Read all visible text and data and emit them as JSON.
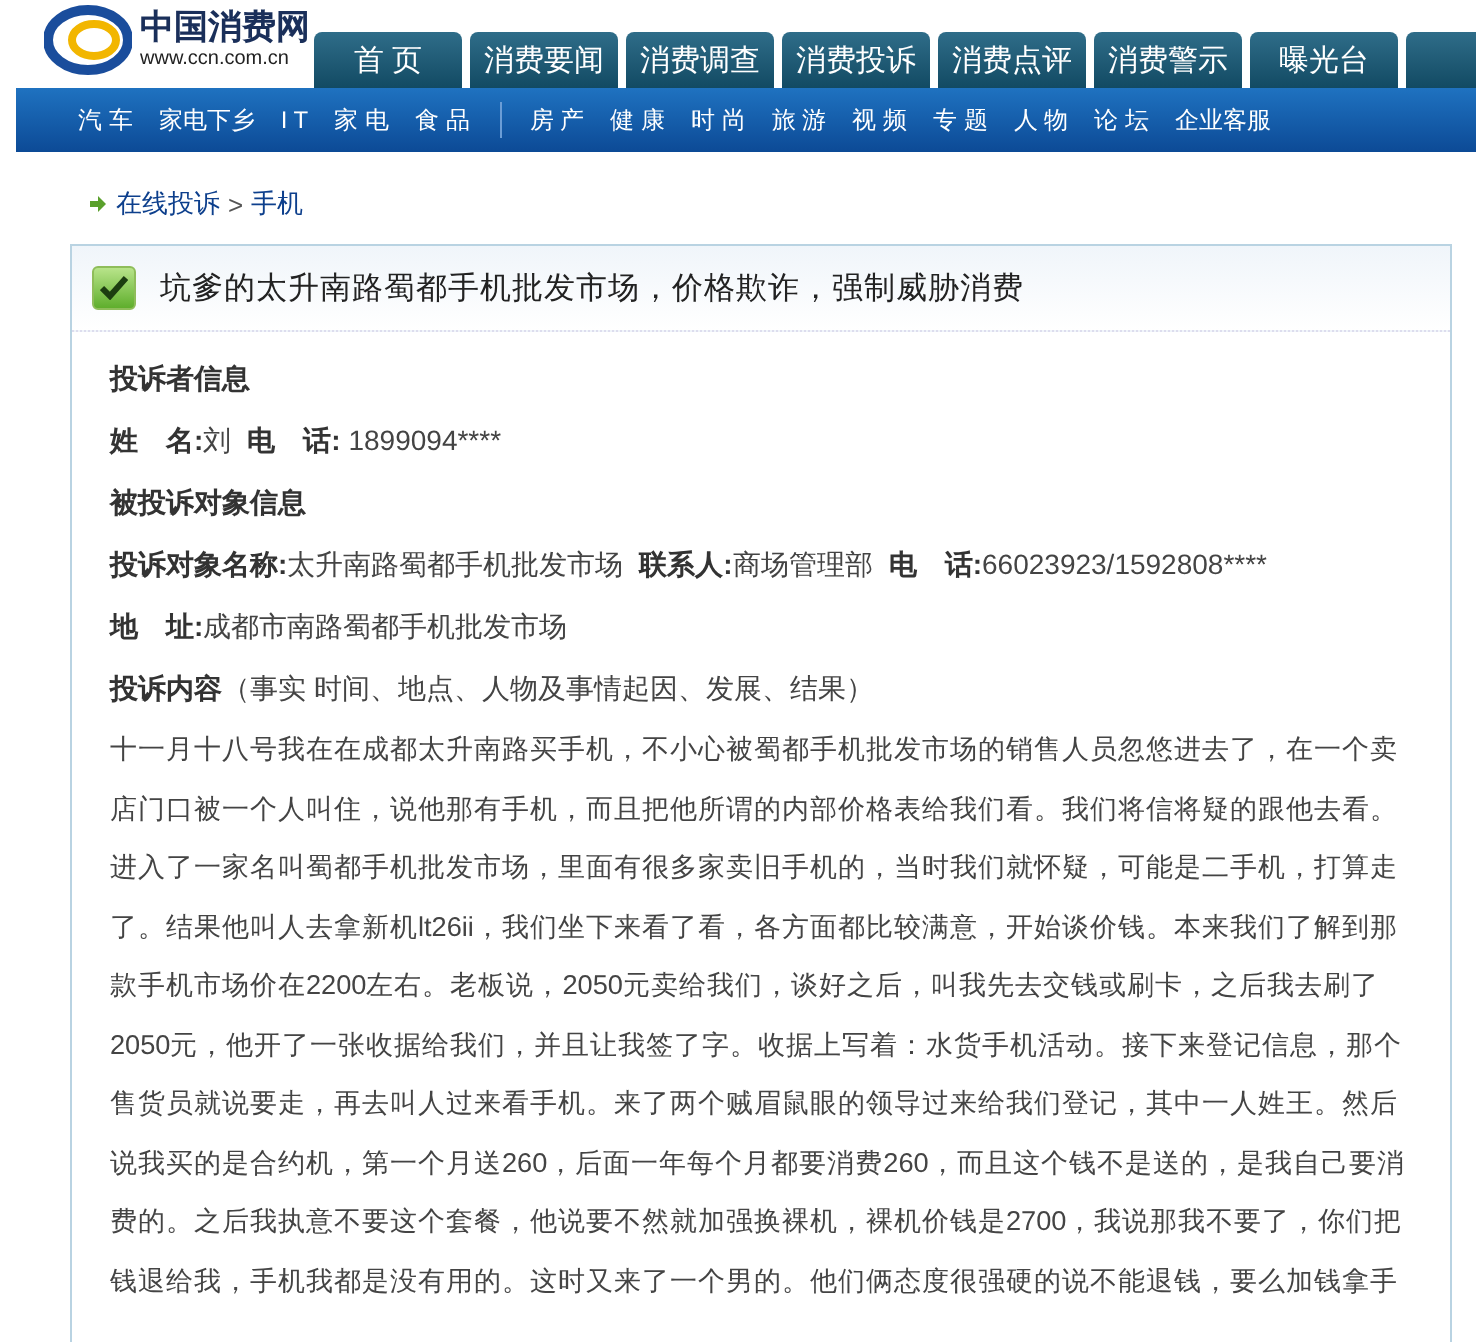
{
  "logo": {
    "name": "中国消费网",
    "url": "www.ccn.com.cn"
  },
  "main_tabs": [
    "首 页",
    "消费要闻",
    "消费调查",
    "消费投诉",
    "消费点评",
    "消费警示",
    "曝光台"
  ],
  "sub_nav": [
    [
      "汽 车",
      "家电下乡",
      "I T",
      "家 电",
      "食 品"
    ],
    [
      "房 产",
      "健 康",
      "时 尚",
      "旅 游",
      "视 频",
      "专 题",
      "人 物",
      "论 坛",
      "企业客服"
    ]
  ],
  "breadcrumb": {
    "items": [
      "在线投诉",
      "手机"
    ],
    "separator": ">"
  },
  "complaint": {
    "title": "坑爹的太升南路蜀都手机批发市场，价格欺诈，强制威胁消费",
    "resolved": true,
    "sections": [
      {
        "kind": "heading",
        "text": "投诉者信息"
      },
      {
        "kind": "fields",
        "fields": [
          {
            "label": "姓　名:",
            "value": "刘"
          },
          {
            "label": "电　话:",
            "value": " 1899094****"
          }
        ]
      },
      {
        "kind": "heading",
        "text": "被投诉对象信息"
      },
      {
        "kind": "fields",
        "fields": [
          {
            "label": "投诉对象名称:",
            "value": "太升南路蜀都手机批发市场"
          },
          {
            "label": "联系人:",
            "value": "商场管理部"
          },
          {
            "label": "电　话:",
            "value": "66023923/1592808****"
          }
        ]
      },
      {
        "kind": "fields",
        "fields": [
          {
            "label": "地　址:",
            "value": "成都市南路蜀都手机批发市场"
          }
        ]
      },
      {
        "kind": "note",
        "text": "**投诉内容**（事实 时间、地点、人物及事情起因、发展、结果）"
      },
      {
        "kind": "body",
        "text": "十一月十八号我在在成都太升南路买手机，不小心被蜀都手机批发市场的销售人员忽悠进去了，在一个卖店门口被一个人叫住，说他那有手机，而且把他所谓的内部价格表给我们看。我们将信将疑的跟他去看。进入了一家名叫蜀都手机批发市场，里面有很多家卖旧手机的，当时我们就怀疑，可能是二手机，打算走了。结果他叫人去拿新机lt26ii，我们坐下来看了看，各方面都比较满意，开始谈价钱。本来我们了解到那款手机市场价在2200左右。老板说，2050元卖给我们，谈好之后，叫我先去交钱或刷卡，之后我去刷了2050元，他开了一张收据给我们，并且让我签了字。收据上写着：水货手机活动。接下来登记信息，那个售货员就说要走，再去叫人过来看手机。来了两个贼眉鼠眼的领导过来给我们登记，其中一人姓王。然后说我买的是合约机，第一个月送260，后面一年每个月都要消费260，而且这个钱不是送的，是我自己要消费的。之后我执意不要这个套餐，他说要不然就加强换裸机，裸机价钱是2700，我说那我不要了，你们把钱退给我，手机我都是没有用的。这时又来了一个男的。他们俩态度很强硬的说不能退钱，要么加钱拿手"
      }
    ]
  }
}
